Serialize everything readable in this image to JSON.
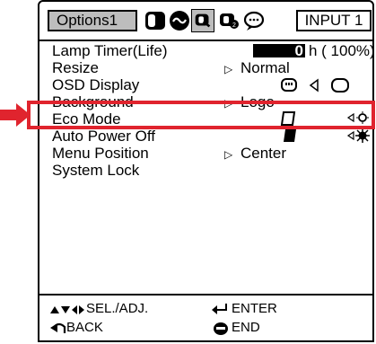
{
  "header": {
    "tab_label": "Options1",
    "input_label": "INPUT 1",
    "icons": [
      "picture-icon",
      "sync-icon",
      "options1-icon",
      "options2-icon",
      "language-icon"
    ]
  },
  "menu": {
    "items": [
      {
        "label": "Lamp Timer(Life)",
        "value_hours": "0",
        "value_unit": "h ( 100%)"
      },
      {
        "label": "Resize",
        "value": "Normal"
      },
      {
        "label": "OSD Display",
        "value": ""
      },
      {
        "label": "Background",
        "value": "Logo"
      },
      {
        "label": "Eco Mode",
        "value": ""
      },
      {
        "label": "Auto Power Off",
        "value": ""
      },
      {
        "label": "Menu Position",
        "value": "Center"
      },
      {
        "label": "System Lock",
        "value": ""
      }
    ]
  },
  "footer": {
    "sel_adj": "SEL./ADJ.",
    "enter": "ENTER",
    "back": "BACK",
    "end": "END"
  },
  "colors": {
    "highlight": "#e0242e",
    "active_tab": "#bdbdbd"
  }
}
